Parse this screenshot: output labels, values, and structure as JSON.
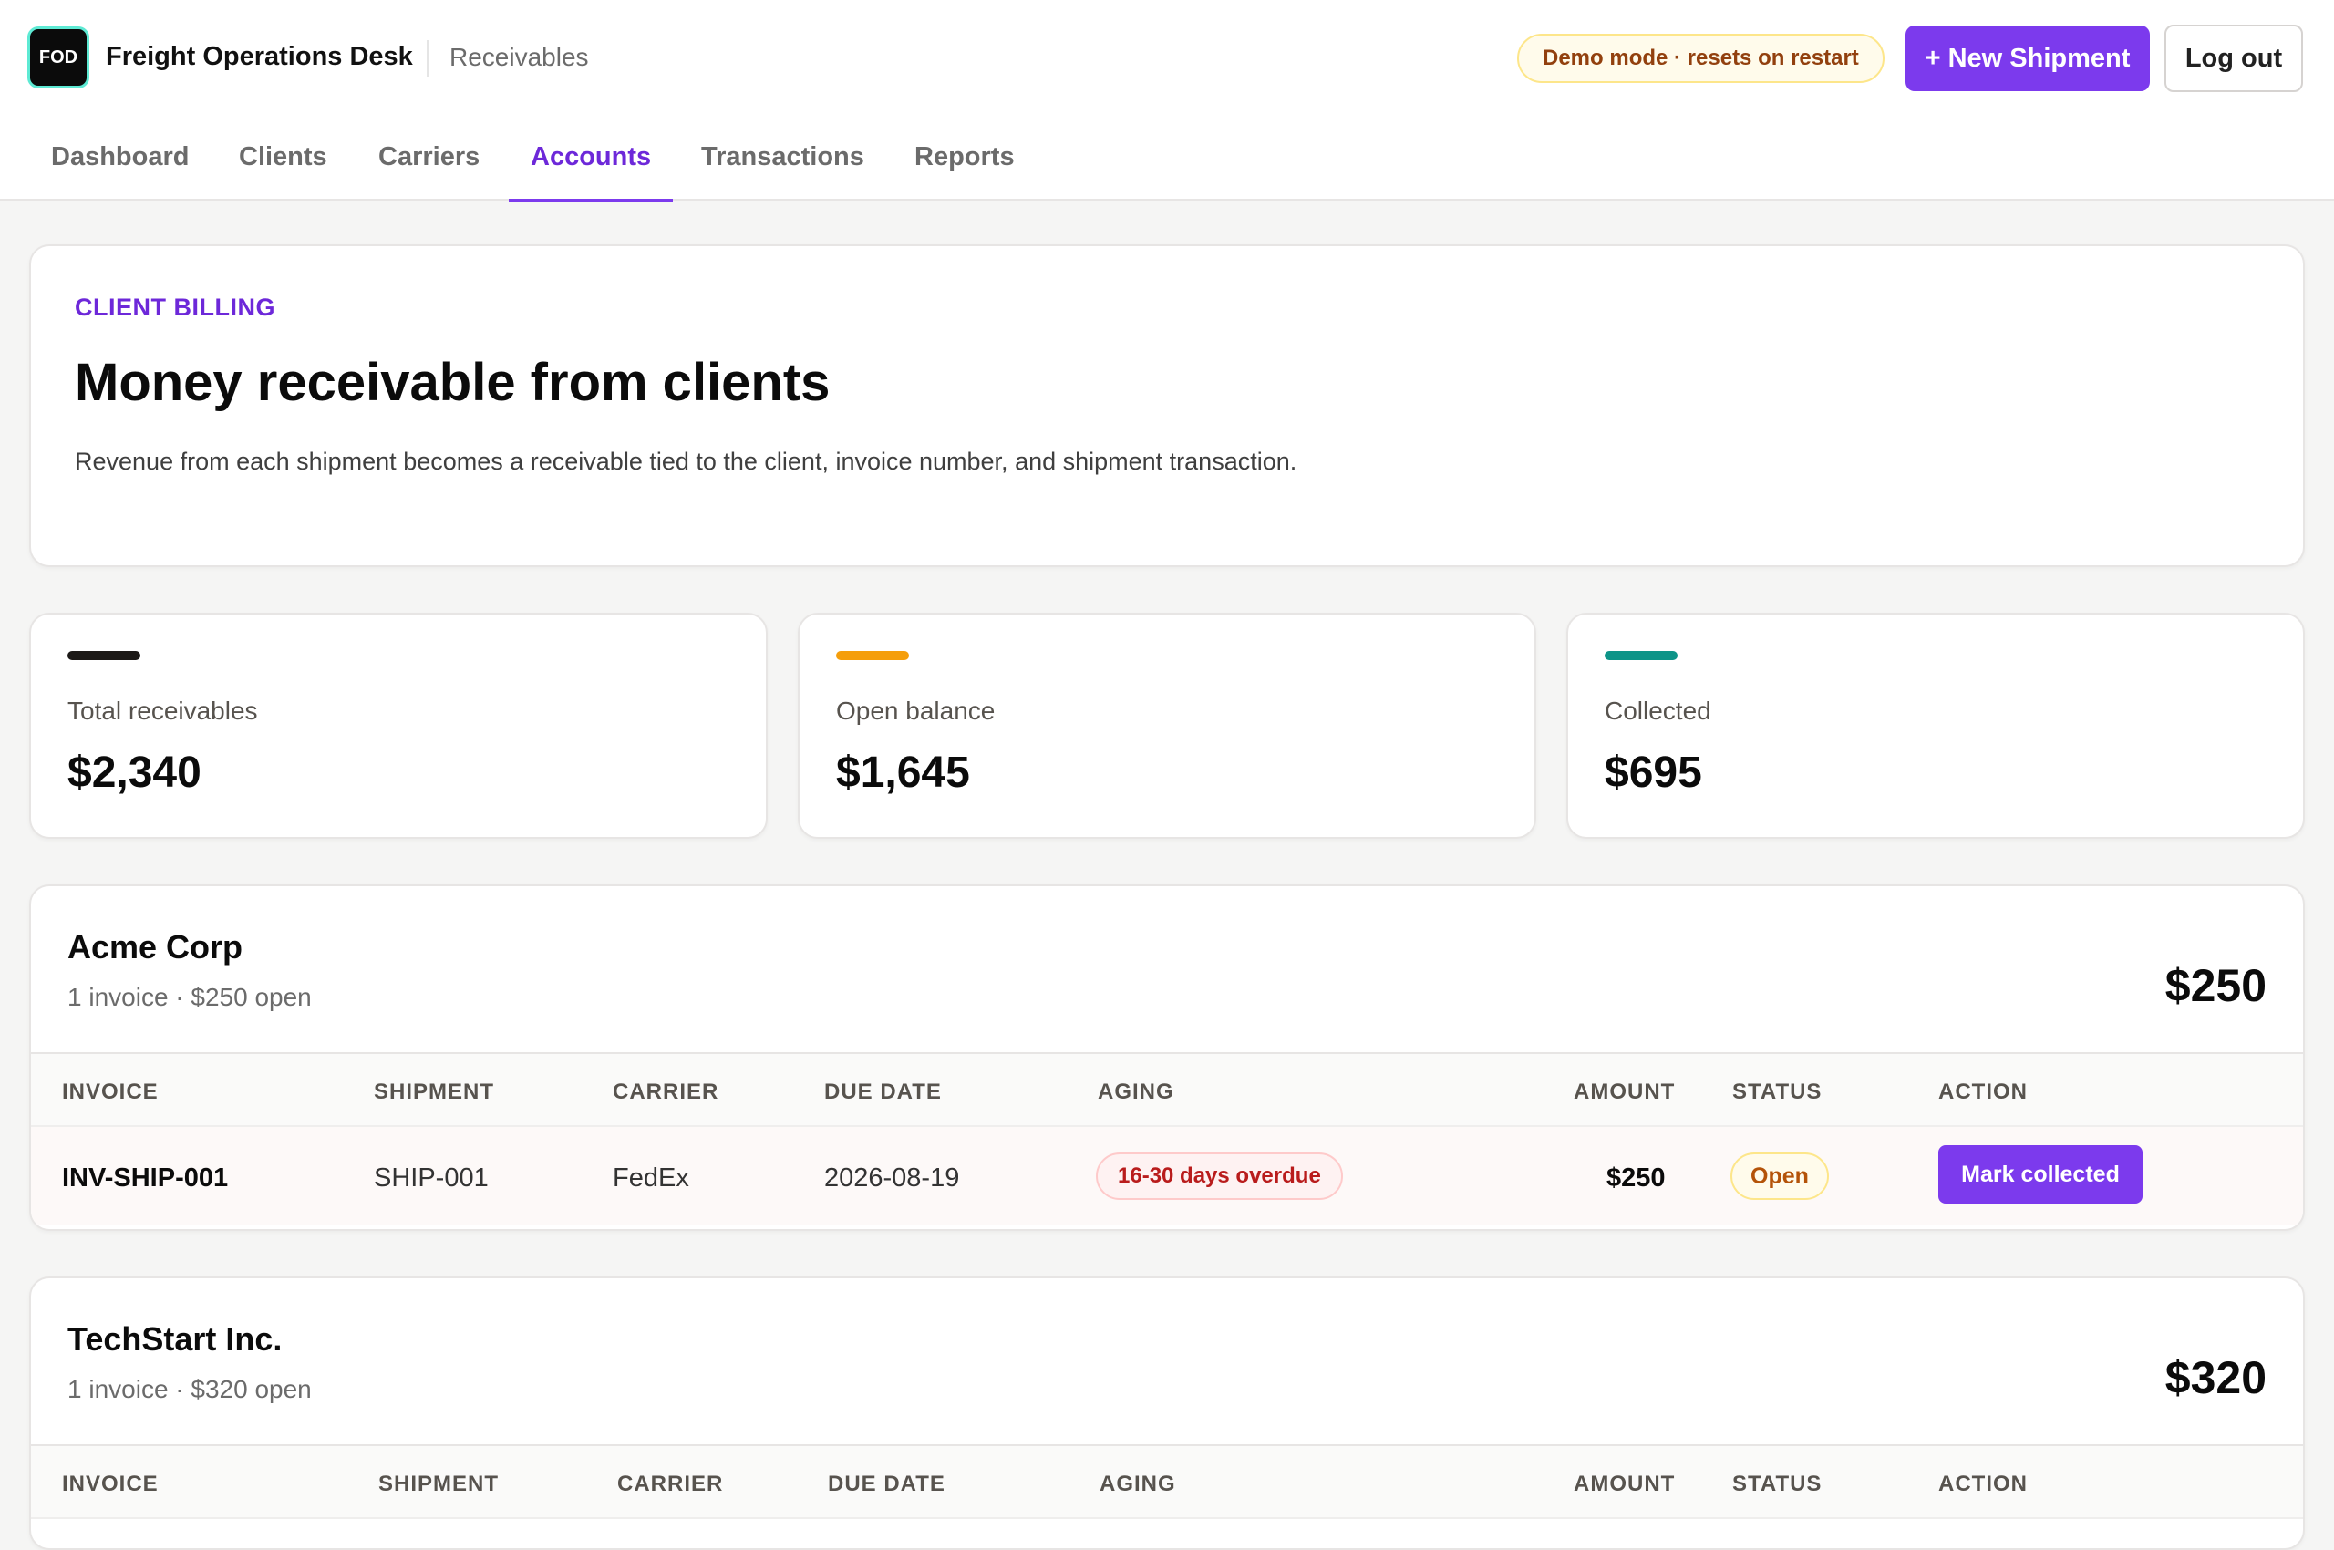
{
  "app": {
    "logo_text": "FOD",
    "title": "Freight Operations Desk",
    "section": "Receivables",
    "demo_badge": "Demo mode · resets on restart",
    "new_shipment_label": "+ New Shipment",
    "logout_label": "Log out"
  },
  "nav": {
    "tabs": [
      {
        "label": "Dashboard",
        "active": false
      },
      {
        "label": "Clients",
        "active": false
      },
      {
        "label": "Carriers",
        "active": false
      },
      {
        "label": "Accounts",
        "active": true
      },
      {
        "label": "Transactions",
        "active": false
      },
      {
        "label": "Reports",
        "active": false
      }
    ]
  },
  "intro": {
    "eyebrow": "CLIENT BILLING",
    "title": "Money receivable from clients",
    "description": "Revenue from each shipment becomes a receivable tied to the client, invoice number, and shipment transaction."
  },
  "stats": [
    {
      "label": "Total receivables",
      "value": "$2,340",
      "color": "#1c1917"
    },
    {
      "label": "Open balance",
      "value": "$1,645",
      "color": "#f59e0b"
    },
    {
      "label": "Collected",
      "value": "$695",
      "color": "#0d9488"
    }
  ],
  "table_headers": {
    "invoice": "INVOICE",
    "shipment": "SHIPMENT",
    "carrier": "CARRIER",
    "due_date": "DUE DATE",
    "aging": "AGING",
    "amount": "AMOUNT",
    "status": "STATUS",
    "action": "ACTION"
  },
  "clients": [
    {
      "name": "Acme Corp",
      "summary": "1 invoice · $250 open",
      "total": "$250",
      "rows": [
        {
          "invoice": "INV-SHIP-001",
          "shipment": "SHIP-001",
          "carrier": "FedEx",
          "due_date": "2026-08-19",
          "aging": "16-30 days overdue",
          "amount": "$250",
          "status": "Open",
          "action": "Mark collected"
        }
      ]
    },
    {
      "name": "TechStart Inc.",
      "summary": "1 invoice · $320 open",
      "total": "$320",
      "rows": []
    }
  ]
}
